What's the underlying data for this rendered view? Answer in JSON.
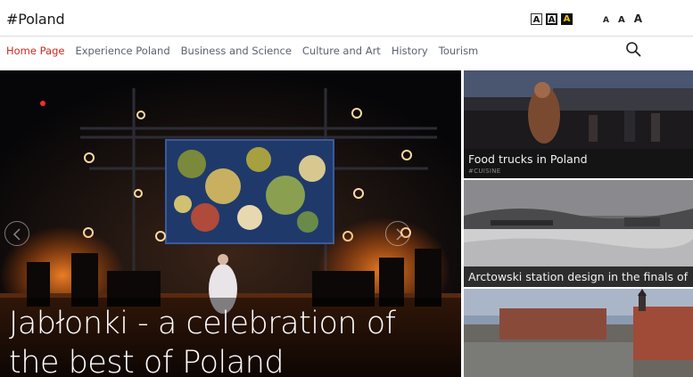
{
  "header": {
    "logo": "#Poland",
    "contrast_options": [
      "A",
      "A",
      "A"
    ],
    "font_sizes": [
      "A",
      "A",
      "A"
    ]
  },
  "nav": {
    "items": [
      {
        "label": "Home Page",
        "active": true
      },
      {
        "label": "Experience Poland",
        "active": false
      },
      {
        "label": "Business and Science",
        "active": false
      },
      {
        "label": "Culture and Art",
        "active": false
      },
      {
        "label": "History",
        "active": false
      },
      {
        "label": "Tourism",
        "active": false
      }
    ]
  },
  "hero": {
    "title": "Jabłonki - a celebration of the best of Poland"
  },
  "cards": [
    {
      "title": "Food trucks in Poland",
      "tag": "#CUISINE"
    },
    {
      "title": "Arctowski station design in the finals of ..."
    },
    {
      "title": ""
    }
  ],
  "colors": {
    "accent": "#cc2a1f",
    "nav_text": "#5a6270",
    "contrast_yellow": "#e8c21a"
  }
}
